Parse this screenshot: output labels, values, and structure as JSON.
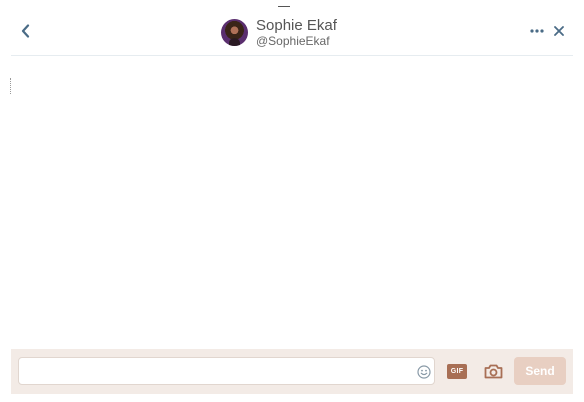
{
  "header": {
    "display_name": "Sophie Ekaf",
    "handle": "@SophieEkaf",
    "avatar_icon": "user-avatar",
    "back_icon": "chevron-left-icon",
    "more_icon": "ellipsis-icon",
    "close_icon": "close-icon"
  },
  "conversation": {
    "messages": []
  },
  "composer": {
    "input_value": "",
    "input_placeholder": "",
    "gif_label": "GIF",
    "send_label": "Send",
    "emoji_icon": "emoji-icon",
    "camera_icon": "camera-icon"
  },
  "colors": {
    "accent": "#a86f55",
    "send_disabled": "#e8cfc2",
    "composer_bg": "#f3ebe6",
    "header_icons": "#4a6b86"
  }
}
